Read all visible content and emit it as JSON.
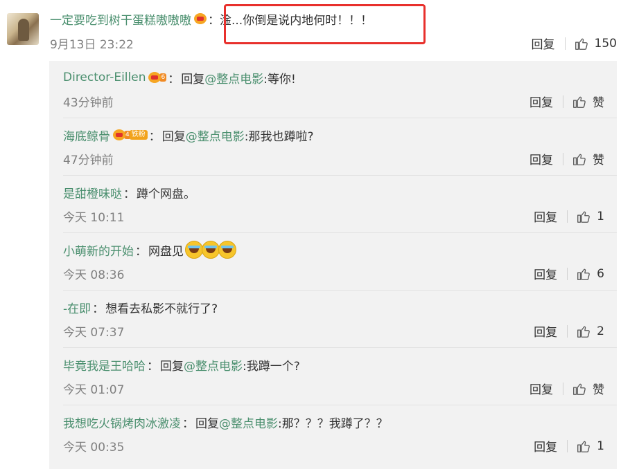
{
  "main_comment": {
    "user": "一定要吃到树干蛋糕嗷嗷嗷",
    "text": "：淦...你倒是说内地何时！！！",
    "time": "9月13日 23:22",
    "reply_label": "回复",
    "likes": "150"
  },
  "replies": [
    {
      "user": "Director-Eillen",
      "badge": "crown-lv-icon",
      "level": "6",
      "prefix": "回复",
      "mention": "@整点电影",
      "text": ":等你!",
      "time": "43分钟前",
      "reply_label": "回复",
      "likes": "赞"
    },
    {
      "user": "海底鲸骨",
      "badge": "crown-fan-icon",
      "level": "4",
      "fan_label": "铁粉",
      "prefix": "回复",
      "mention": "@整点电影",
      "text": ":那我也蹲啦?",
      "time": "47分钟前",
      "reply_label": "回复",
      "likes": "赞"
    },
    {
      "user": "是甜橙味哒",
      "text": "蹲个网盘。",
      "time": "今天 10:11",
      "reply_label": "回复",
      "likes": "1"
    },
    {
      "user": "小萌新的开始",
      "text": "网盘见",
      "emoji": "crying-laugh-emoji",
      "time": "今天 08:36",
      "reply_label": "回复",
      "likes": "6"
    },
    {
      "user": "-在即",
      "text": "想看去私影不就行了?",
      "time": "今天 07:37",
      "reply_label": "回复",
      "likes": "2"
    },
    {
      "user": "毕竟我是王哈哈",
      "prefix": "回复",
      "mention": "@整点电影",
      "text": ":我蹲一个?",
      "time": "今天 01:07",
      "reply_label": "回复",
      "likes": "赞"
    },
    {
      "user": "我想吃火锅烤肉冰激凌",
      "prefix": "回复",
      "mention": "@整点电影",
      "text": ":那？？？我蹲了？？",
      "time": "今天 00:35",
      "reply_label": "回复",
      "likes": "1"
    }
  ],
  "colors": {
    "username": "#4a8f6e",
    "highlight": "#e8302c",
    "reply_bg": "#f2f2f2"
  },
  "colon": "："
}
